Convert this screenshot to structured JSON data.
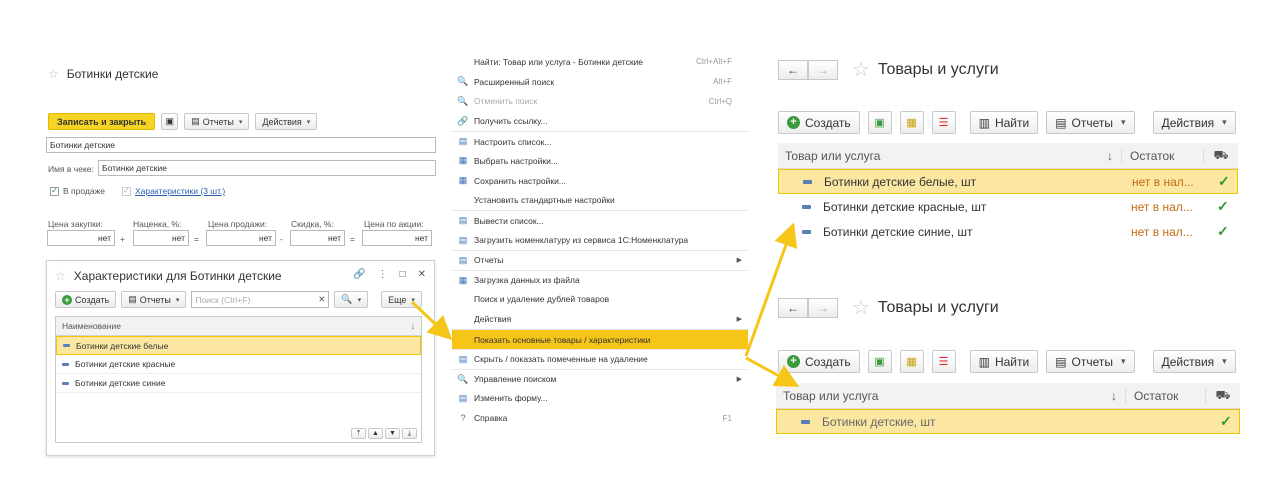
{
  "panel1": {
    "title": "Ботинки детские",
    "toolbar": {
      "save_close": "Записать и закрыть",
      "reports": "Отчеты",
      "actions": "Действия"
    },
    "name_value": "Ботинки детские",
    "receipt_label": "Имя в чеке:",
    "receipt_value": "Ботинки детские",
    "on_sale_label": "В продаже",
    "characteristics_link": "Характеристики (3 шт.)",
    "price_labels": [
      "Цена закупки:",
      "Наценка, %:",
      "Цена продажи:",
      "Скидка, %:",
      "Цена по акции:"
    ],
    "price_values": [
      "нет",
      "нет",
      "нет",
      "нет",
      "нет"
    ],
    "operators": [
      "+",
      "=",
      "-",
      "="
    ]
  },
  "sub": {
    "title": "Характеристики для Ботинки детские",
    "create": "Создать",
    "reports": "Отчеты",
    "search_placeholder": "Поиск (Ctrl+F)",
    "more": "Еще",
    "col_name": "Наименование",
    "rows": [
      "Ботинки детские белые",
      "Ботинки детские красные",
      "Ботинки детские синие"
    ]
  },
  "menu": {
    "items": [
      {
        "label": "Найти: Товар или услуга - Ботинки детские",
        "shortcut": "Ctrl+Alt+F",
        "icon": ""
      },
      {
        "label": "Расширенный поиск",
        "shortcut": "Alt+F",
        "icon": "🔍"
      },
      {
        "label": "Отменить поиск",
        "shortcut": "Ctrl+Q",
        "icon": "🔍"
      },
      {
        "label": "Получить ссылку...",
        "shortcut": "",
        "icon": "🔗"
      },
      {
        "label": "Настроить список...",
        "shortcut": "",
        "icon": "▤"
      },
      {
        "label": "Выбрать настройки...",
        "shortcut": "",
        "icon": "▦"
      },
      {
        "label": "Сохранить настройки...",
        "shortcut": "",
        "icon": "▦"
      },
      {
        "label": "Установить стандартные настройки",
        "shortcut": "",
        "icon": ""
      },
      {
        "label": "Вывести список...",
        "shortcut": "",
        "icon": "▤"
      },
      {
        "label": "Загрузить номенклатуру из сервиса 1С:Номенклатура",
        "shortcut": "",
        "icon": "▤"
      },
      {
        "label": "Отчеты",
        "shortcut": "",
        "icon": "▤"
      },
      {
        "label": "Загрузка данных из файла",
        "shortcut": "",
        "icon": "▦"
      },
      {
        "label": "Поиск и удаление дублей товаров",
        "shortcut": "",
        "icon": ""
      },
      {
        "label": "Действия",
        "shortcut": "",
        "icon": ""
      },
      {
        "label": "Показать основные товары / характеристики",
        "shortcut": "",
        "icon": ""
      },
      {
        "label": "Скрыть / показать помеченные на удаление",
        "shortcut": "",
        "icon": "▤"
      },
      {
        "label": "Управление поиском",
        "shortcut": "",
        "icon": "🔍"
      },
      {
        "label": "Изменить форму...",
        "shortcut": "",
        "icon": "▤"
      },
      {
        "label": "Справка",
        "shortcut": "F1",
        "icon": "?"
      }
    ]
  },
  "list_top": {
    "title": "Товары и услуги",
    "create": "Создать",
    "find": "Найти",
    "reports": "Отчеты",
    "actions": "Действия",
    "col_item": "Товар или услуга",
    "col_stock": "Остаток",
    "rows": [
      {
        "name": "Ботинки детские белые, шт",
        "stock": "нет в нал..."
      },
      {
        "name": "Ботинки детские красные, шт",
        "stock": "нет в нал..."
      },
      {
        "name": "Ботинки детские синие, шт",
        "stock": "нет в нал..."
      }
    ]
  },
  "list_bottom": {
    "title": "Товары и услуги",
    "create": "Создать",
    "find": "Найти",
    "reports": "Отчеты",
    "actions": "Действия",
    "col_item": "Товар или услуга",
    "col_stock": "Остаток",
    "rows": [
      {
        "name": "Ботинки детские, шт",
        "stock": ""
      }
    ]
  },
  "colors": {
    "accent": "#f5c518",
    "selection": "#fbe7a2",
    "link": "#2a5db0",
    "stock": "#c56a14",
    "check": "#2d9a2d"
  }
}
